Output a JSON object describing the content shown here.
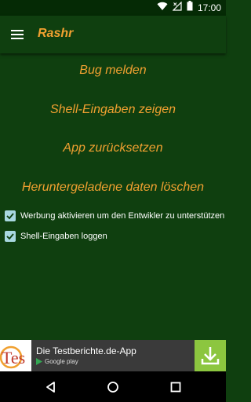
{
  "status_bar": {
    "time": "17:00",
    "icons": [
      "wifi-icon",
      "signal-icon",
      "battery-icon"
    ]
  },
  "app_bar": {
    "title": "Rashr",
    "menu_icon": "hamburger-menu-icon"
  },
  "menu": {
    "items": [
      {
        "label": "Bug melden"
      },
      {
        "label": "Shell-Eingaben zeigen"
      },
      {
        "label": "App zurücksetzen"
      },
      {
        "label": "Heruntergeladene daten löschen"
      }
    ]
  },
  "options": {
    "checkboxes": [
      {
        "label": "Werbung aktivieren um den Entwikler zu unterstützen",
        "checked": true
      },
      {
        "label": "Shell-Eingaben loggen",
        "checked": true
      }
    ]
  },
  "ad_banner": {
    "logo_text": "Tes",
    "title": "Die Testberichte.de-App",
    "store_label": "Google play",
    "download_icon": "download-icon"
  },
  "nav_bar": {
    "icons": [
      "back-icon",
      "home-icon",
      "recents-icon"
    ]
  },
  "colors": {
    "background": "#0f3f0f",
    "status_bar": "#052a05",
    "accent": "#f0a030",
    "checkbox": "#a8d8e0",
    "ad_download": "#8cc63f"
  }
}
